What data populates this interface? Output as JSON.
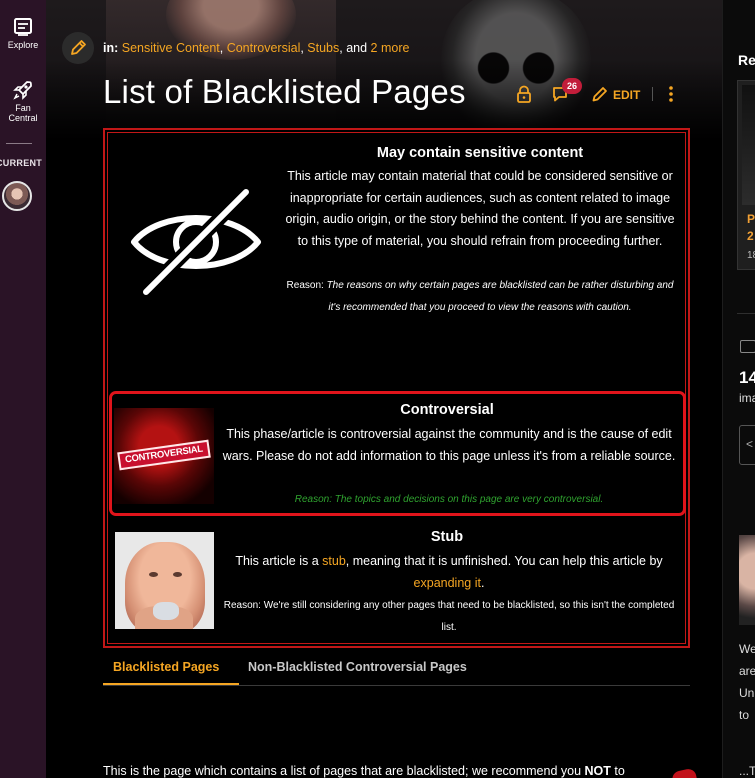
{
  "rail": {
    "explore_label": "Explore",
    "fan_central_label_1": "Fan",
    "fan_central_label_2": "Central",
    "current_label": "CURRENT"
  },
  "breadcrumb": {
    "prefix": "in:",
    "categories": [
      "Sensitive Content",
      "Controversial",
      "Stubs"
    ],
    "sep1": ", ",
    "sep2": ", ",
    "sep3": ", and ",
    "more": "2 more"
  },
  "page": {
    "title": "List of Blacklisted Pages",
    "comment_count": "26",
    "edit_label": "EDIT"
  },
  "notices": {
    "sensitive": {
      "title": "May contain sensitive content",
      "body": "This article may contain material that could be considered sensitive or inappropriate for certain audiences, such as content related to image origin, audio origin, or the story behind the content. If you are sensitive to this type of material, you should refrain from proceeding further.",
      "reason_prefix": "Reason:",
      "reason_text": "The reasons on why certain pages are blacklisted can be rather disturbing and it's recommended that you proceed to view the reasons with caution."
    },
    "controversial": {
      "title": "Controversial",
      "image_label": "CONTROVERSIAL",
      "body": "This phase/article is controversial against the community and is the cause of edit wars. Please do not add information to this page unless it's from a reliable source.",
      "reason": "Reason: The topics and decisions on this page are very controversial."
    },
    "stub": {
      "title": "Stub",
      "body_1": "This article is a ",
      "stub_link": "stub",
      "body_2": ", meaning that it is unfinished. You can help this article by ",
      "expand_link": "expanding it",
      "body_3": ".",
      "reason": "Reason: We're still considering any other pages that need to be blacklisted, so this isn't the completed list."
    }
  },
  "tabs": {
    "active": "Blacklisted Pages",
    "inactive": "Non-Blacklisted Controversial Pages"
  },
  "intro": {
    "text_1": "This is the page which contains a list of pages that are blacklisted; we recommend you ",
    "bold": "NOT",
    "text_2": " to"
  },
  "right_rail": {
    "title": "Re",
    "card_line_1": "P",
    "card_line_2": "2",
    "card_meta": "18",
    "image_count": "14",
    "image_label": "ima",
    "carousel_prev": "<",
    "lines": [
      "We",
      "are",
      "Un",
      "to"
    ],
    "bottom": "...T"
  },
  "colors": {
    "accent": "#f5a623",
    "notice_border": "#c21717",
    "controversial_border": "#e0141b",
    "reason_green": "#2fa32f",
    "badge": "#c21d3a",
    "rail_bg": "#2a1326"
  },
  "icons": [
    "explore-icon",
    "rocket-icon",
    "pencil-icon",
    "lock-icon",
    "comment-icon",
    "edit-pencil-icon",
    "more-vertical-icon",
    "eye-slash-icon",
    "image-icon"
  ]
}
